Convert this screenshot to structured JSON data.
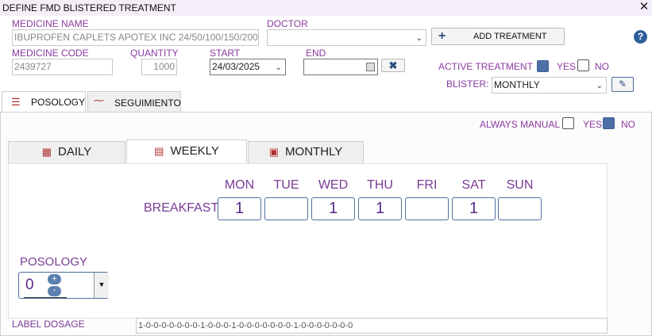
{
  "window": {
    "title": "DEFINE FMD BLISTERED TREATMENT",
    "close_glyph": "✕"
  },
  "medicine_name": {
    "label": "MEDICINE NAME",
    "value": "IBUPROFEN CAPLETS APOTEX INC 24/50/100/150/200"
  },
  "doctor": {
    "label": "DOCTOR",
    "value": ""
  },
  "add_treatment": {
    "label": "ADD TREATMENT",
    "icon": "plus-icon",
    "glyph": "+"
  },
  "help": {
    "glyph": "?"
  },
  "medicine_code": {
    "label": "MEDICINE CODE",
    "value": "2439727"
  },
  "quantity": {
    "label": "QUANTITY",
    "value": "1000"
  },
  "start": {
    "label": "START",
    "value": "24/03/2025"
  },
  "end": {
    "label": "END",
    "value": ""
  },
  "active_treatment": {
    "label": "ACTIVE TREATMENT",
    "yes_label": "YES",
    "no_label": "NO",
    "selected": "none"
  },
  "blister": {
    "label": "BLISTER:",
    "value": "MONTHLY"
  },
  "tabs": {
    "posology": "POSOLOGY",
    "seguimiento": "SEGUIMIENTO"
  },
  "always_manual": {
    "label": "ALWAYS MANUAL",
    "yes_label": "YES",
    "no_label": "NO",
    "selected": "no"
  },
  "schedule_tabs": [
    {
      "label": "DAILY",
      "icon": "calendar-grid-icon"
    },
    {
      "label": "WEEKLY",
      "icon": "calendar-icon"
    },
    {
      "label": "MONTHLY",
      "icon": "calendar-month-icon"
    }
  ],
  "weekly": {
    "row_label": "BREAKFAST",
    "days": [
      "MON",
      "TUE",
      "WED",
      "THU",
      "FRI",
      "SAT",
      "SUN"
    ],
    "values": [
      "1",
      "",
      "1",
      "1",
      "",
      "1",
      ""
    ]
  },
  "posology": {
    "label": "POSOLOGY",
    "value": "0",
    "plus": "+",
    "minus": "-"
  },
  "label_dosage": {
    "label": "LABEL DOSAGE",
    "value": "1-0-0-0-0-0-0-0-1-0-0-0-1-0-0-0-0-0-0-0-1-0-0-0-0-0-0-0"
  },
  "colors": {
    "accent": "#8a3aa0",
    "checkbox_on": "#4c6fa6",
    "help": "#2f5f9b"
  }
}
